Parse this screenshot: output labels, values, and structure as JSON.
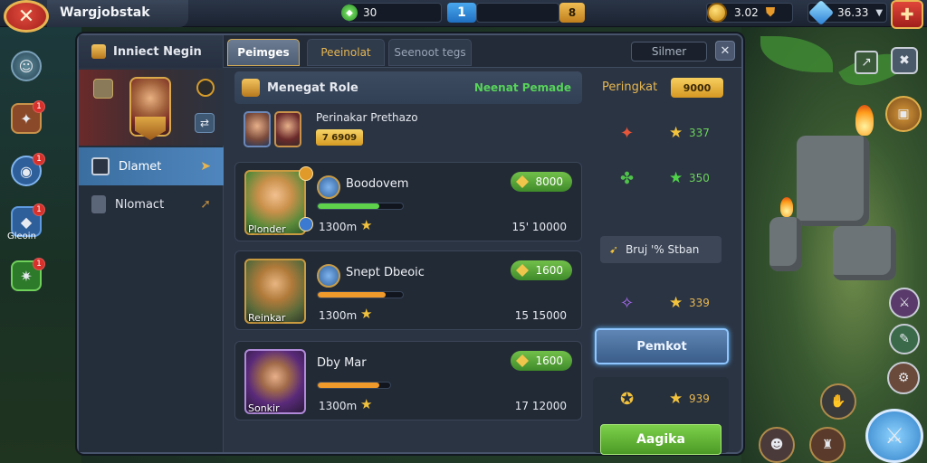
{
  "header": {
    "title": "Wargjobstak",
    "gems": "30",
    "level": "1",
    "level_rank": "8",
    "coins": "3.02",
    "diamonds": "36.33"
  },
  "panel": {
    "main_tab": "Inniect Negin",
    "tabs": [
      "Peimges",
      "Peeinolat",
      "Seenoot tegs"
    ],
    "search_placeholder": "Silmer",
    "sidebar": {
      "items": [
        {
          "label": "Dlamet"
        },
        {
          "label": "Nlomact"
        }
      ]
    },
    "list": {
      "header": "Menegat Role",
      "header_note": "Neenat Pemade",
      "intro_name": "Perinakar Prethazo",
      "intro_value": "7 6909",
      "cards": [
        {
          "name": "Boodovem",
          "portrait_label": "Plonder",
          "stat": "1300m",
          "score": "15' 10000",
          "reward": "8000",
          "progress": 0.72,
          "bar_color": "#5fd24b"
        },
        {
          "name": "Snept Dbeoic",
          "portrait_label": "Reinkar",
          "stat": "1300m",
          "score": "15 15000",
          "reward": "1600",
          "progress": 0.8,
          "bar_color": "#f09a2c"
        },
        {
          "name": "Dby Mar",
          "portrait_label": "Sonkir",
          "stat": "1300m",
          "score": "17 12000",
          "reward": "1600",
          "progress": 0.85,
          "bar_color": "#f09a2c"
        }
      ]
    },
    "rewards": {
      "title": "Peringkat",
      "value": "9000",
      "rows": [
        {
          "value": "337"
        },
        {
          "value": "350"
        },
        {
          "value": "339"
        },
        {
          "value": "939"
        }
      ],
      "bonus": "Bruj '% Stban",
      "primary_button": "Pemkot",
      "secondary_button": "Aagika"
    }
  },
  "left_rail": {
    "gift_label": "Gleoin",
    "badges": [
      "1",
      "1",
      "1",
      "1"
    ]
  },
  "colors": {
    "accent_gold": "#e8b852",
    "accent_green": "#57d35a",
    "accent_blue": "#4f86bd"
  }
}
